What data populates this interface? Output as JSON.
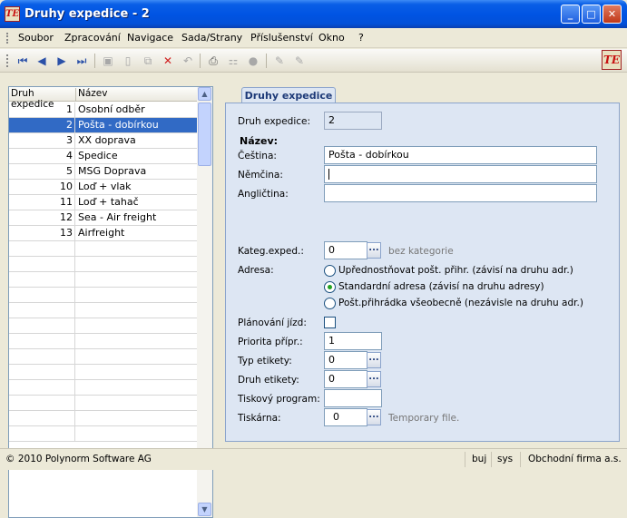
{
  "window": {
    "title": "Druhy expedice - 2",
    "icon_text": "TE",
    "minimize": "_",
    "maximize": "□",
    "close": "✕"
  },
  "menu": [
    "Soubor",
    "Zpracování",
    "Navigace",
    "Sada/Strany",
    "Příslušenství",
    "Okno",
    "?"
  ],
  "toolbar": {
    "icons": [
      "first-record-icon",
      "previous-record-icon",
      "next-record-icon",
      "last-record-icon",
      "save-icon",
      "new-record-icon",
      "copy-icon",
      "delete-icon",
      "undo-icon",
      "print-icon",
      "tree-icon",
      "lookup-icon",
      "edit-icon",
      "edit-disabled-icon"
    ],
    "logo_text": "TE"
  },
  "grid": {
    "columns": [
      "Druh expedice",
      "Název"
    ],
    "rows": [
      {
        "id": "1",
        "name": "Osobní odběr"
      },
      {
        "id": "2",
        "name": "Pošta - dobírkou",
        "selected": true
      },
      {
        "id": "3",
        "name": "XX doprava"
      },
      {
        "id": "4",
        "name": "Spedice"
      },
      {
        "id": "5",
        "name": "MSG Doprava"
      },
      {
        "id": "10",
        "name": "Loď + vlak"
      },
      {
        "id": "11",
        "name": "Loď + tahač"
      },
      {
        "id": "12",
        "name": "Sea - Air freight"
      },
      {
        "id": "13",
        "name": "Airfreight"
      }
    ],
    "empty_rows": 13
  },
  "form": {
    "tab_label": "Druhy expedice",
    "druh_expedice": {
      "label": "Druh expedice:",
      "value": "2"
    },
    "nazev_header": "Název:",
    "cestina": {
      "label": "Čeština:",
      "value": "Pošta - dobírkou"
    },
    "nemcina": {
      "label": "Němčina:",
      "value": ""
    },
    "anglictina": {
      "label": "Angličtina:",
      "value": ""
    },
    "kateg_exped": {
      "label": "Kateg.exped.:",
      "value": "0",
      "hint": "bez kategorie"
    },
    "adresa": {
      "label": "Adresa:",
      "options": [
        "Upřednostňovat pošt. přihr. (závisí na druhu adr.)",
        "Standardní adresa (závisí na druhu adresy)",
        "Pošt.přihrádka všeobecně (nezávisle na druhu adr.)"
      ],
      "selected_index": 1
    },
    "planovani_jizd": {
      "label": "Plánování jízd:",
      "checked": false
    },
    "priorita_pripr": {
      "label": "Priorita přípr.:",
      "value": "1"
    },
    "typ_etikety": {
      "label": "Typ etikety:",
      "value": "0"
    },
    "druh_etikety": {
      "label": "Druh etikety:",
      "value": "0"
    },
    "tiskovy_program": {
      "label": "Tiskový program:",
      "value": ""
    },
    "tiskarna": {
      "label": "Tiskárna:",
      "value": "0",
      "hint": "Temporary file."
    },
    "ellipsis": "..."
  },
  "statusbar": {
    "copyright": "© 2010 Polynorm Software AG",
    "user": "buj",
    "system": "sys",
    "company": "Obchodní firma a.s."
  }
}
